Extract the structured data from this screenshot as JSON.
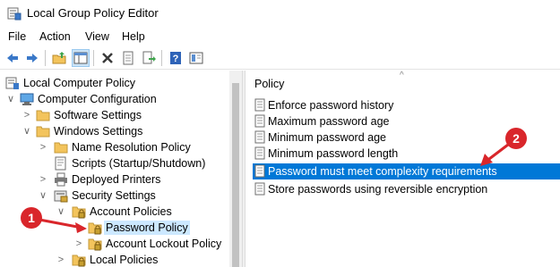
{
  "window": {
    "title": "Local Group Policy Editor"
  },
  "menu": [
    "File",
    "Action",
    "View",
    "Help"
  ],
  "toolbar": [
    {
      "name": "back-arrow-icon"
    },
    {
      "name": "forward-arrow-icon"
    },
    {
      "name": "up-folder-icon"
    },
    {
      "name": "show-hide-tree-icon"
    },
    {
      "name": "delete-icon"
    },
    {
      "name": "properties-icon"
    },
    {
      "name": "export-list-icon"
    },
    {
      "name": "help-icon"
    },
    {
      "name": "extended-view-icon"
    }
  ],
  "tree": [
    {
      "label": "Local Computer Policy",
      "expander": "",
      "icon": "computer-policy-icon"
    },
    {
      "label": "Computer Configuration",
      "expander": "∨",
      "icon": "computer-icon"
    },
    {
      "label": "Software Settings",
      "expander": ">",
      "icon": "folder-icon"
    },
    {
      "label": "Windows Settings",
      "expander": "∨",
      "icon": "folder-icon"
    },
    {
      "label": "Name Resolution Policy",
      "expander": ">",
      "icon": "folder-icon"
    },
    {
      "label": "Scripts (Startup/Shutdown)",
      "expander": "",
      "icon": "scripts-icon"
    },
    {
      "label": "Deployed Printers",
      "expander": ">",
      "icon": "printer-icon"
    },
    {
      "label": "Security Settings",
      "expander": "∨",
      "icon": "security-icon"
    },
    {
      "label": "Account Policies",
      "expander": "∨",
      "icon": "folder-lock-icon"
    },
    {
      "label": "Password Policy",
      "expander": ">",
      "icon": "folder-lock-icon",
      "selected": true
    },
    {
      "label": "Account Lockout Policy",
      "expander": ">",
      "icon": "folder-lock-icon"
    },
    {
      "label": "Local Policies",
      "expander": ">",
      "icon": "folder-lock-icon"
    }
  ],
  "list": {
    "column_header": "Policy",
    "sort_indicator": "^",
    "items": [
      {
        "label": "Enforce password history"
      },
      {
        "label": "Maximum password age"
      },
      {
        "label": "Minimum password age"
      },
      {
        "label": "Minimum password length"
      },
      {
        "label": "Password must meet complexity requirements",
        "selected": true
      },
      {
        "label": "Store passwords using reversible encryption"
      }
    ]
  },
  "annotations": {
    "step1": "1",
    "step2": "2",
    "color": "#d9262b"
  },
  "colors": {
    "selection": "#0078d7",
    "tree_selection": "#cce8ff",
    "folder": "#f3c45c"
  }
}
